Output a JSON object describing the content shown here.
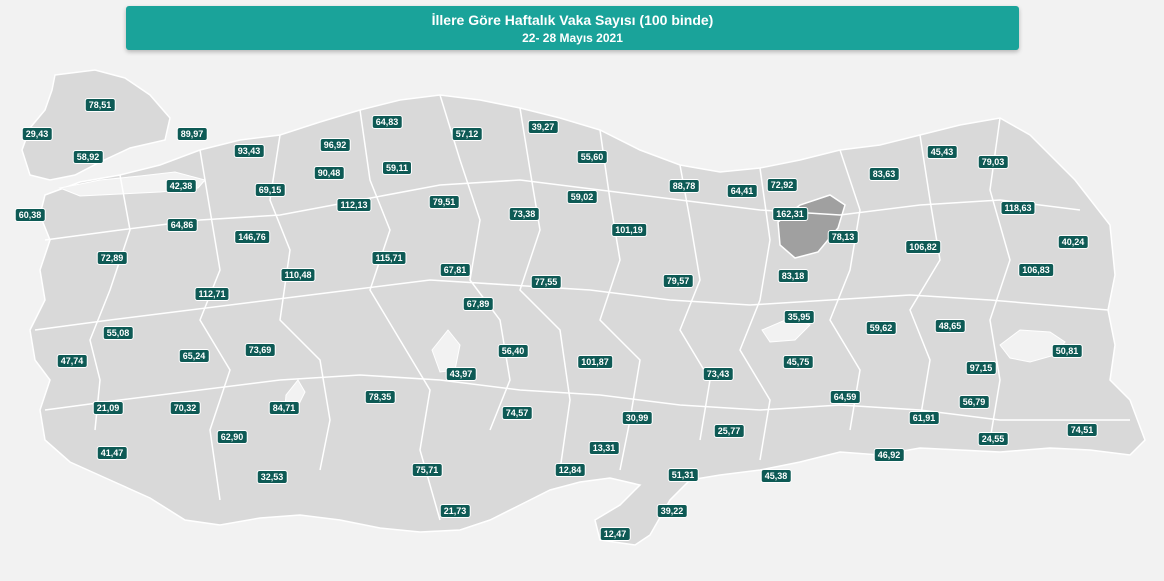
{
  "header": {
    "title": "İllere Göre Haftalık Vaka Sayısı (100 binde)",
    "subtitle": "22- 28 Mayıs 2021"
  },
  "colors": {
    "header_bg": "#1aa39a",
    "province_fill": "#d9d9d9",
    "province_border": "#ffffff",
    "highlight_fill": "#a0a0a0",
    "label_bg": "#0e5a55",
    "background": "#f2f2f2"
  },
  "labels": [
    "78,51",
    "29,43",
    "89,97",
    "58,92",
    "93,43",
    "96,92",
    "64,83",
    "57,12",
    "39,27",
    "55,60",
    "42,38",
    "69,15",
    "90,48",
    "59,11",
    "72,92",
    "83,63",
    "45,43",
    "79,03",
    "60,38",
    "64,86",
    "112,13",
    "79,51",
    "73,38",
    "59,02",
    "88,78",
    "64,41",
    "162,31",
    "118,63",
    "146,76",
    "101,19",
    "78,13",
    "106,82",
    "40,24",
    "72,89",
    "110,48",
    "115,71",
    "67,81",
    "106,83",
    "112,71",
    "77,55",
    "79,57",
    "83,18",
    "67,89",
    "35,95",
    "59,62",
    "48,65",
    "55,08",
    "65,24",
    "73,69",
    "56,40",
    "101,87",
    "50,81",
    "47,74",
    "43,97",
    "73,43",
    "45,75",
    "97,15",
    "78,35",
    "64,59",
    "56,79",
    "21,09",
    "70,32",
    "84,71",
    "74,57",
    "30,99",
    "61,91",
    "62,90",
    "25,77",
    "24,55",
    "74,51",
    "41,47",
    "13,31",
    "46,92",
    "12,84",
    "75,71",
    "51,31",
    "45,38",
    "32,53",
    "21,73",
    "39,22",
    "12,47"
  ]
}
